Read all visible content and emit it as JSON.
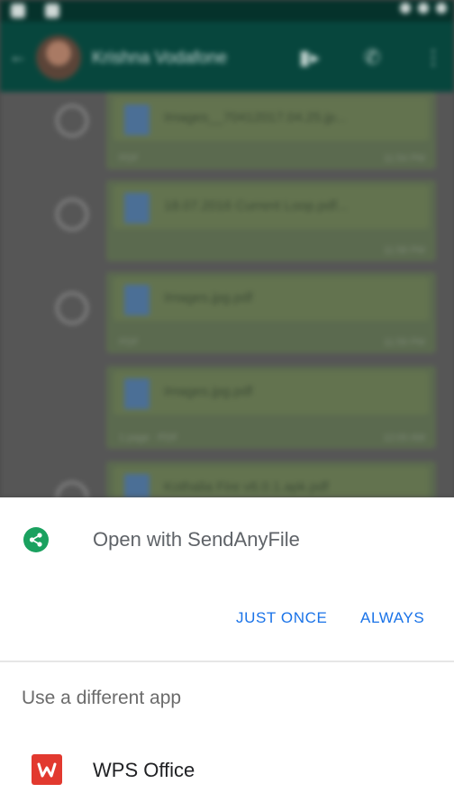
{
  "background": {
    "contact_name": "Krishna Vodafone",
    "messages": [
      {
        "file_name": "Images__70412017.04.25.jp...",
        "meta_left": "PDF",
        "meta_right": "11:54 PM"
      },
      {
        "file_name": "18.07.2016 Current Loop.pdf...",
        "meta_left": "",
        "meta_right": "11:58 PM"
      },
      {
        "file_name": "Images.jpg.pdf",
        "meta_left": "PDF",
        "meta_right": "11:59 PM"
      },
      {
        "file_name": "Images.jpg.pdf",
        "meta_left": "1 page · PDF",
        "meta_right": "12:00 AM"
      },
      {
        "file_name": "Kothalia Fire v6.0.1.apk.pdf",
        "meta_left": "",
        "meta_right": ""
      }
    ]
  },
  "sheet": {
    "open_with_label": "Open with SendAnyFile",
    "just_once_label": "JUST ONCE",
    "always_label": "ALWAYS",
    "different_app_label": "Use a different app",
    "apps": [
      {
        "name": "WPS Office",
        "icon": "wps-office-icon"
      }
    ]
  },
  "colors": {
    "accent_blue": "#1a73e8",
    "share_green": "#1aa15f",
    "wps_red": "#e2392f",
    "app_bar_teal": "#07463d"
  }
}
